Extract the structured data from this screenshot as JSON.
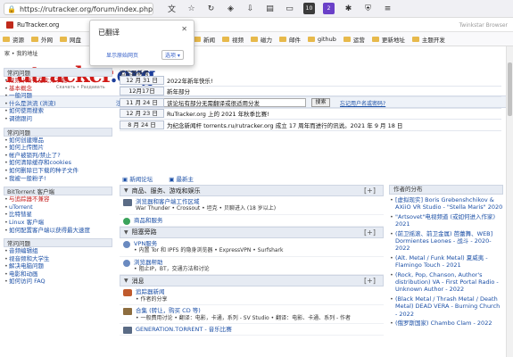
{
  "browser": {
    "url": "https://rutracker.org/forum/index.php",
    "window_title_right": "Twinkstar Browser",
    "ext_icon_1": "10",
    "ext_icon_2": "2"
  },
  "tab": {
    "title": "RuTracker.org"
  },
  "bookmarks": [
    "资源",
    "外网",
    "网盘",
    "设计",
    "新闻",
    "视频",
    "磁力",
    "邮件",
    "github",
    "运营",
    "更新地址",
    "主题开发"
  ],
  "popup": {
    "title": "已翻译",
    "show_original": "显示原始网页",
    "options": "选项"
  },
  "page": {
    "breadcrumb": "家 • 我的地址",
    "logo_part1": "rutracker",
    "logo_part2": ".org",
    "slogan": "Скачать • Раздавать",
    "search": {
      "register": "注册",
      "login": "登录",
      "button": "搜索",
      "forgot": "忘记用户名或密码?"
    }
  },
  "sidebar": [
    {
      "heading": "常问问题",
      "items": [
        {
          "text": "规则 | 所有在此外下载",
          "red": true
        },
        {
          "text": "基本概念",
          "red": true
        },
        {
          "text": "一般问题",
          "red": false
        },
        {
          "text": "什么是洪流 (洪流)",
          "red": false
        },
        {
          "text": "如何使用搜索",
          "red": false
        },
        {
          "text": "调德跟问",
          "red": false
        }
      ]
    },
    {
      "heading": "常问问题",
      "items": [
        {
          "text": "如何创建赠品",
          "red": false
        },
        {
          "text": "如何上传图片",
          "red": false
        },
        {
          "text": "帐户被锁判/禁止了?",
          "red": false
        },
        {
          "text": "如何清除缓存和cookies",
          "red": false
        },
        {
          "text": "如何删除已下载的种子文件",
          "red": false
        },
        {
          "text": "我被一般粉子!",
          "red": false
        }
      ]
    },
    {
      "heading": "BitTorrent 客户端",
      "items": [
        {
          "text": "与追踪器不兼容",
          "red": true
        },
        {
          "text": "uTorrent",
          "red": false
        },
        {
          "text": "比特彗星",
          "red": false
        },
        {
          "text": "Linux 客户端",
          "red": false
        },
        {
          "text": "如何配置客户端以获得最大速度",
          "red": false
        }
      ]
    },
    {
      "heading": "常问问题",
      "items": [
        {
          "text": "音频编辑组",
          "red": false
        },
        {
          "text": "视音频和大学生",
          "red": false
        },
        {
          "text": "解决电脑问题",
          "red": false
        },
        {
          "text": "电影和动画",
          "red": false
        },
        {
          "text": "如何访问 FAQ",
          "red": false
        }
      ]
    }
  ],
  "news": {
    "title": "追踪器新闻",
    "rows": [
      {
        "date": "12 月 31 日",
        "text": "2022年新年快乐!"
      },
      {
        "date": "12月17日",
        "text": "新年部分"
      },
      {
        "date": "11 月 24 日",
        "text": "该论坛有部分无需翻译或很适用分发"
      },
      {
        "date": "12 月 23 日",
        "text": "RuTracker.org 上的 2021 年秋季比赛!"
      },
      {
        "date": "8 月 24 日",
        "text": "为纪念新闻杆 torrents.ru/rutracker.org 成立 17 周年而进行的讯说。2021 年 9 月 18 日"
      }
    ],
    "footer_links": [
      "新闻论坛",
      "最新主"
    ]
  },
  "categories": [
    {
      "title": "商品、服务、游戏和娱乐",
      "items": [
        {
          "icon": "film",
          "name": "浏览器和客户端工作区域",
          "sub": "War Thunder • Crossout • 坦克 • 贝聊进入 (18 岁以上)"
        },
        {
          "icon": "ok",
          "name": "商品和服务",
          "sub": ""
        }
      ]
    },
    {
      "title": "阻塞旁路",
      "items": [
        {
          "icon": "web",
          "name": "VPN服务",
          "sub": "• 内置 Tor 和 IPFS 的隐身浏览器 • ExpressVPN • Surfshark"
        },
        {
          "icon": "web",
          "name": "浏览器帮助",
          "sub": "• 阻止IP，BT，交通方法和讨论"
        }
      ]
    },
    {
      "title": "消息",
      "items": [
        {
          "icon": "game",
          "name": "追踪器新闻",
          "sub": "• 作者的分享"
        },
        {
          "icon": "book",
          "name": "合集 (转让，购买 CD 等)",
          "sub": "• 一般费用讨论 • 翻译：电影，卡通，系列 - SV Studio • 翻译：电影、卡通、系列 - 作者"
        },
        {
          "icon": "film",
          "name": "GENERATION.TORRENT - 音乐比赛",
          "sub": ""
        }
      ]
    }
  ],
  "releases": {
    "title": "作者的分布",
    "items": [
      "[虚拟现实] Boris Grebenshchikov & AXiiO VR Studio - \"Stella Maris\" 2020",
      "\"Artsovet\"电视频道 (或如何进入作家) 2021",
      "(前卫摇滚、前卫金属) 芭蕾舞、WEB] Dormientes Leones - 战斗 - 2020-2022",
      "(Alt. Metal / Funk Metal) 夏威夷 - Flamingo Touch - 2021",
      "(Rock, Pop, Chanson, Author's distribution) VA - First Portal Radio - Unknown Author - 2022",
      "(Black Metal / Thrash Metal / Death Metal) DEAD VERA - Burning Church - 2022",
      "(俄罗斯国家) Chambo Clam - 2022"
    ]
  }
}
